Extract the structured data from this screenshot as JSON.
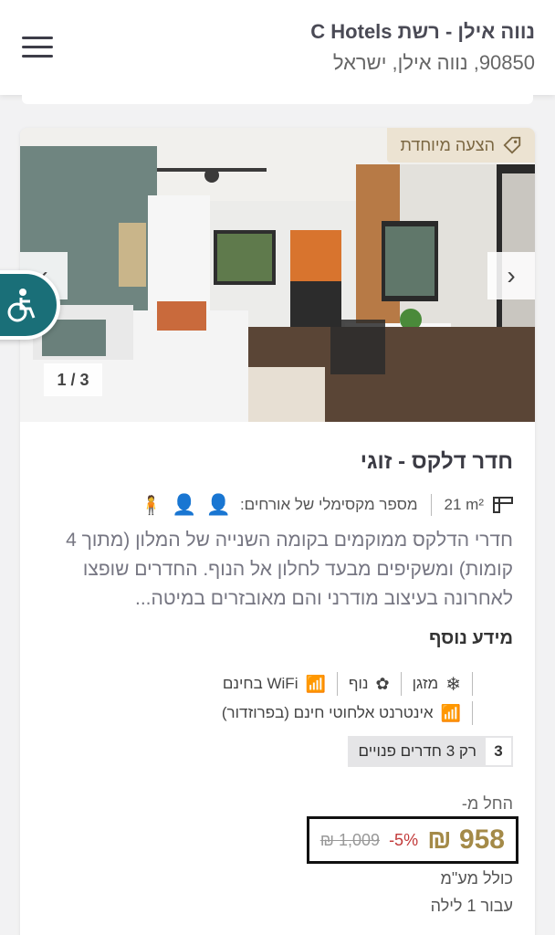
{
  "header": {
    "hotel_name": "נווה אילן - רשת C Hotels",
    "address": "90850, נווה אילן, ישראל"
  },
  "room": {
    "badge": "הצעה מיוחדת",
    "counter": "1 / 3",
    "title": "חדר דלקס - זוגי",
    "size": "21 m²",
    "max_guests_label": "מספר מקסימלי של אורחים:",
    "description": "חדרי הדלקס ממוקמים בקומה השנייה של המלון (מתוך 4 קומות) ומשקיפים מבעד לחלון אל הנוף. החדרים שופצו לאחרונה בעיצוב מודרני והם מאובזרים במיטה...",
    "more_info_heading": "מידע נוסף",
    "amenities": {
      "ac": "מזגן",
      "view": "נוף",
      "wifi": "WiFi בחינם",
      "internet": "אינטרנט אלחוטי חינם (בפרוזדור)"
    },
    "rooms_left_count": "3",
    "rooms_left_text": "רק 3 חדרים פנויים",
    "price_from": "החל מ-",
    "price_new": "958 ₪",
    "discount": "-5%",
    "price_old": "1,009 ₪",
    "vat_note": "כולל מע\"מ",
    "per_night": "עבור 1 לילה"
  },
  "colors": {
    "accent_gold": "#a48a48",
    "badge_bg": "#ece3d2",
    "access_teal": "#1a6f78",
    "discount_red": "#c23a3a"
  },
  "icons": [
    "hamburger-menu-icon",
    "tag-icon",
    "chevron-left-icon",
    "chevron-right-icon",
    "wheelchair-icon",
    "ruler-icon",
    "guest-icon",
    "snowflake-icon",
    "view-icon",
    "wifi-icon"
  ]
}
